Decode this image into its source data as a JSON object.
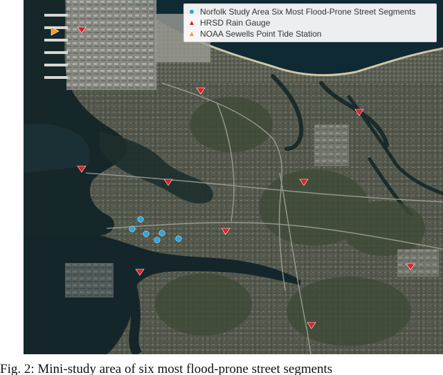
{
  "legend": {
    "items": [
      {
        "label": "Norfolk Study Area Six Most Flood-Prone Street Segments",
        "icon": "blue-circle-icon",
        "color": "#2aa7e0"
      },
      {
        "label": "HRSD Rain Gauge",
        "icon": "red-triangle-icon",
        "color": "#e02020"
      },
      {
        "label": "NOAA Sewells Point Tide Station",
        "icon": "orange-triangle-icon",
        "color": "#f29a1f"
      }
    ]
  },
  "caption": "Fig. 2: Mini-study area of six most flood-prone street segments"
}
